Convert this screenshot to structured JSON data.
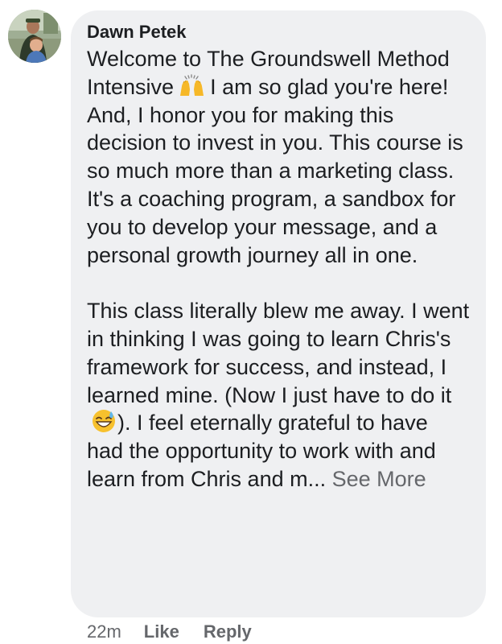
{
  "comment": {
    "author": "Dawn Petek",
    "paragraph_1_before_emoji": "Welcome to The Groundswell Method Intensive",
    "paragraph_1_after_emoji": "I am so glad you're here!  And, I honor you for making this decision to invest in you.  This course is so much more than a marketing class.  It's a coaching program, a sandbox for you to develop your message, and a personal growth journey all in one.",
    "paragraph_2_before_emoji": "This class literally blew me away.  I went in thinking I was going to learn Chris's framework for success, and instead, I learned mine.  (Now I just have to do it",
    "paragraph_2_after_emoji": ").  I feel eternally grateful to have had the opportunity to work with and learn from Chris and m...",
    "see_more": "See More",
    "emoji_1": "raising-hands-emoji",
    "emoji_2": "grinning-sweat-emoji"
  },
  "actions": {
    "timestamp": "22m",
    "like": "Like",
    "reply": "Reply"
  },
  "colors": {
    "bubble": "#eff0f2",
    "text": "#1c1e21",
    "secondary": "#65676b"
  }
}
